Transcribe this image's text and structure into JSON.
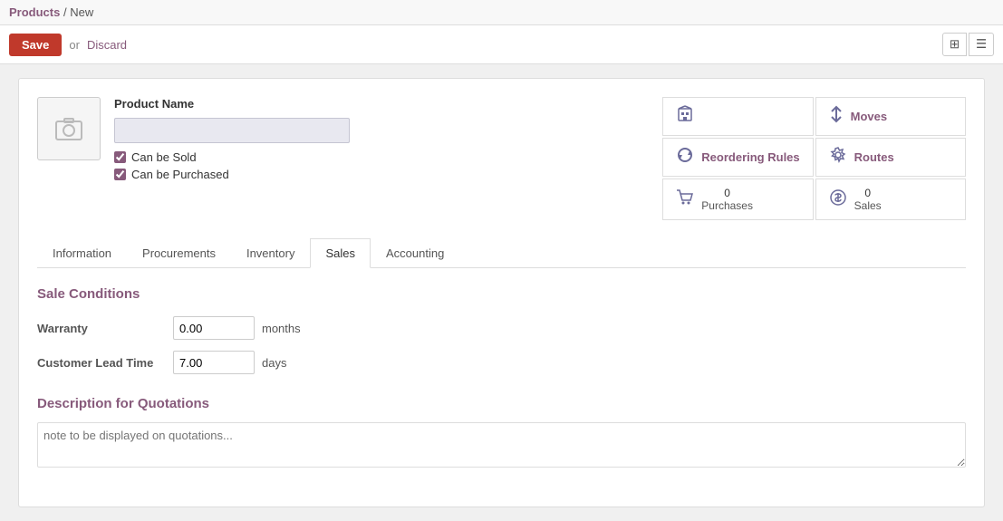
{
  "breadcrumb": {
    "parent": "Products",
    "separator": "/",
    "current": "New"
  },
  "toolbar": {
    "save_label": "Save",
    "or_text": "or",
    "discard_label": "Discard"
  },
  "product": {
    "name_label": "Product Name",
    "name_value": "",
    "can_be_sold_label": "Can be Sold",
    "can_be_purchased_label": "Can be Purchased",
    "can_be_sold_checked": true,
    "can_be_purchased_checked": true
  },
  "stats": [
    {
      "id": "stat-building",
      "icon": "building",
      "label": ""
    },
    {
      "id": "stat-moves",
      "icon": "arrow-up",
      "label": "Moves"
    },
    {
      "id": "stat-reordering",
      "icon": "refresh",
      "label": "Reordering Rules"
    },
    {
      "id": "stat-routes",
      "icon": "gear",
      "label": "Routes"
    },
    {
      "id": "stat-purchases",
      "icon": "cart",
      "count": "0",
      "label": "Purchases"
    },
    {
      "id": "stat-sales",
      "icon": "dollar",
      "count": "0",
      "label": "Sales"
    }
  ],
  "tabs": [
    {
      "id": "tab-information",
      "label": "Information",
      "active": false
    },
    {
      "id": "tab-procurements",
      "label": "Procurements",
      "active": false
    },
    {
      "id": "tab-inventory",
      "label": "Inventory",
      "active": false
    },
    {
      "id": "tab-sales",
      "label": "Sales",
      "active": true
    },
    {
      "id": "tab-accounting",
      "label": "Accounting",
      "active": false
    }
  ],
  "sale_conditions": {
    "section_title": "Sale Conditions",
    "warranty_label": "Warranty",
    "warranty_value": "0.00",
    "warranty_unit": "months",
    "customer_lead_time_label": "Customer Lead Time",
    "customer_lead_time_value": "7.00",
    "customer_lead_time_unit": "days"
  },
  "description_section": {
    "title": "Description for Quotations",
    "placeholder": "note to be displayed on quotations..."
  },
  "view_icons": {
    "grid": "⊞",
    "list": "☰"
  }
}
